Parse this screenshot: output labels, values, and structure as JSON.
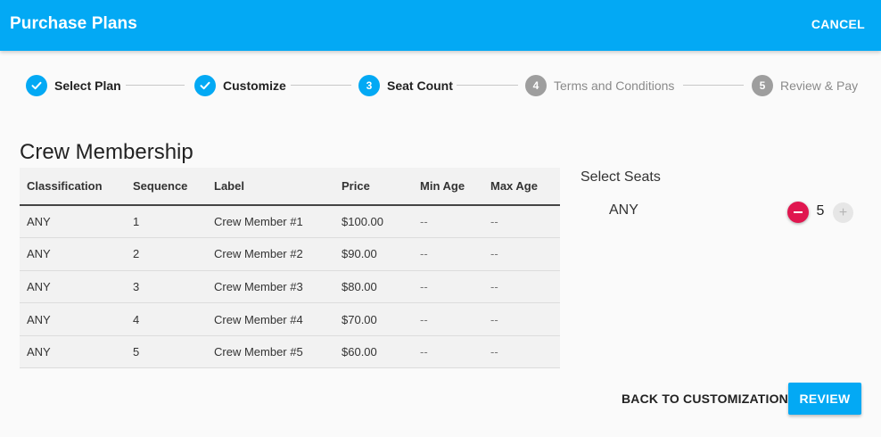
{
  "header": {
    "title": "Purchase Plans",
    "cancel_label": "CANCEL"
  },
  "stepper": {
    "steps": [
      {
        "label": "Select Plan",
        "state": "done",
        "icon": "check-icon"
      },
      {
        "label": "Customize",
        "state": "done",
        "icon": "check-icon"
      },
      {
        "label": "Seat Count",
        "state": "active",
        "number": "3"
      },
      {
        "label": "Terms and Conditions",
        "state": "todo",
        "number": "4"
      },
      {
        "label": "Review & Pay",
        "state": "todo",
        "number": "5"
      }
    ]
  },
  "membership": {
    "title": "Crew Membership",
    "columns": [
      "Classification",
      "Sequence",
      "Label",
      "Price",
      "Min Age",
      "Max Age"
    ],
    "rows": [
      [
        "ANY",
        "1",
        "Crew Member #1",
        "$100.00",
        "--",
        "--"
      ],
      [
        "ANY",
        "2",
        "Crew Member #2",
        "$90.00",
        "--",
        "--"
      ],
      [
        "ANY",
        "3",
        "Crew Member #3",
        "$80.00",
        "--",
        "--"
      ],
      [
        "ANY",
        "4",
        "Crew Member #4",
        "$70.00",
        "--",
        "--"
      ],
      [
        "ANY",
        "5",
        "Crew Member #5",
        "$60.00",
        "--",
        "--"
      ]
    ]
  },
  "seats": {
    "title": "Select Seats",
    "classification": "ANY",
    "count": "5",
    "decrement_icon": "minus-icon",
    "increment_icon": "plus-icon"
  },
  "footer": {
    "back_label": "BACK TO CUSTOMIZATION",
    "review_label": "REVIEW"
  },
  "colors": {
    "primary": "#03a9f4",
    "danger": "#e0164f",
    "inactive_step": "#9e9e9e"
  }
}
